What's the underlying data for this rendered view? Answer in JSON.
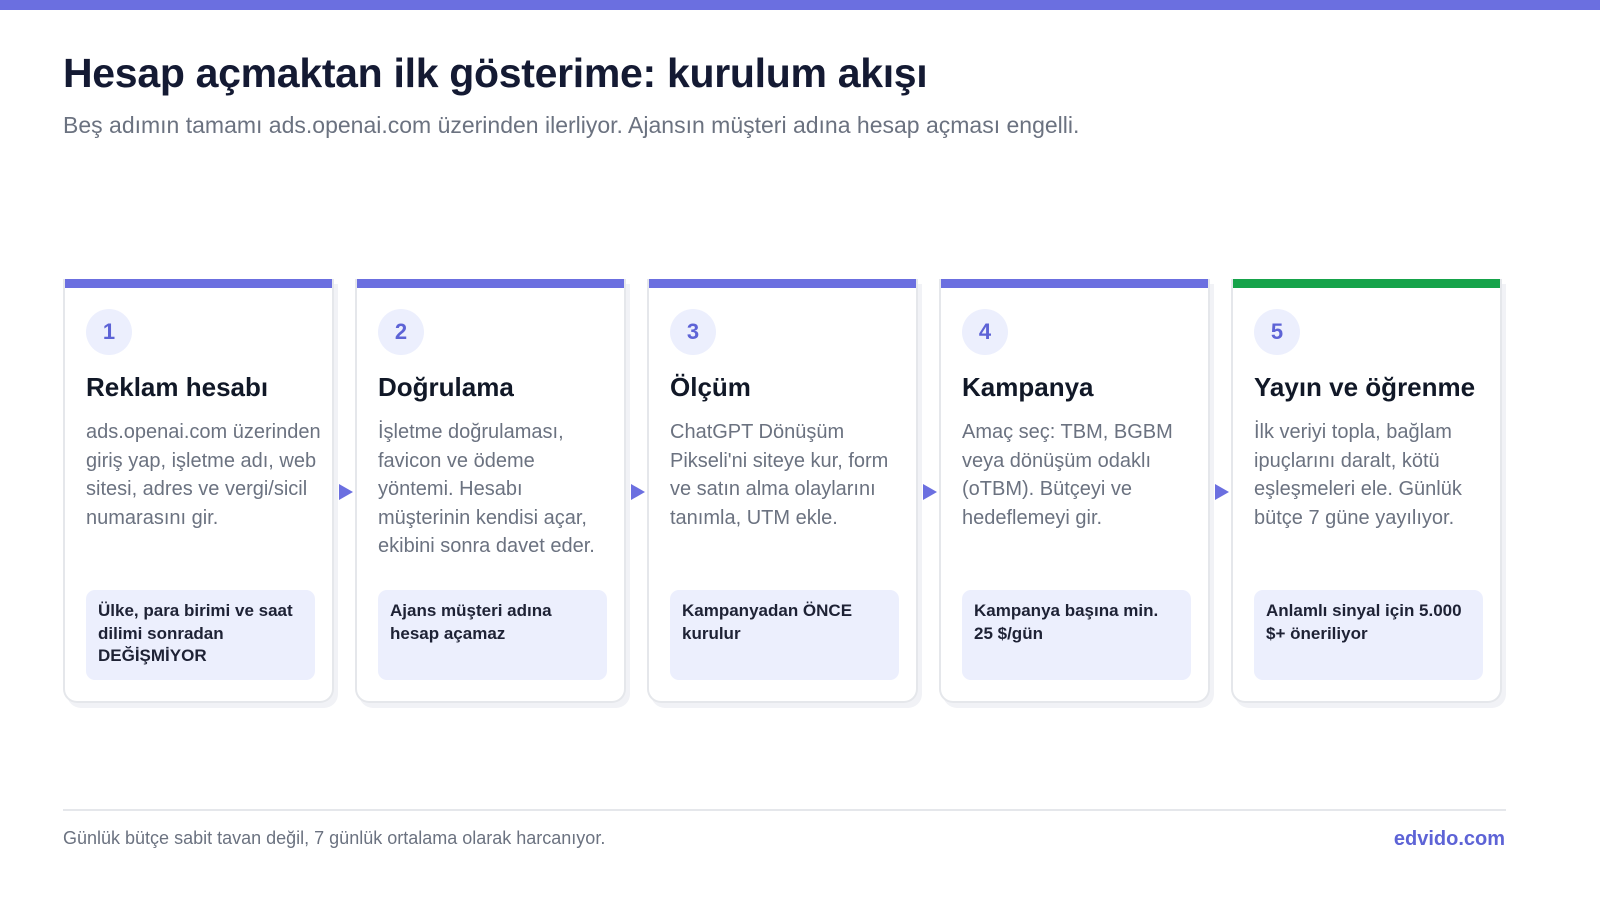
{
  "header": {
    "title": "Hesap açmaktan ilk gösterime: kurulum akışı",
    "subtitle": "Beş adımın tamamı ads.openai.com üzerinden ilerliyor. Ajansın müşteri adına hesap açması engelli."
  },
  "colors": {
    "accent": "#6b6fe0",
    "final_accent": "#16a34a",
    "badge_bg": "#eceffd",
    "note_bg": "#eceffd"
  },
  "steps": [
    {
      "number": "1",
      "title": "Reklam hesabı",
      "description": "ads.openai.com üzerinden giriş yap, işletme adı, web sitesi, adres ve vergi/sicil numarasını gir.",
      "note": "Ülke, para birimi ve saat dilimi sonradan DEĞİŞMİYOR"
    },
    {
      "number": "2",
      "title": "Doğrulama",
      "description": "İşletme doğrulaması, favicon ve ödeme yöntemi. Hesabı müşterinin kendisi açar, ekibini sonra davet eder.",
      "note": "Ajans müşteri adına hesap açamaz"
    },
    {
      "number": "3",
      "title": "Ölçüm",
      "description": "ChatGPT Dönüşüm Pikseli'ni siteye kur, form ve satın alma olaylarını tanımla, UTM ekle.",
      "note": "Kampanyadan ÖNCE kurulur"
    },
    {
      "number": "4",
      "title": "Kampanya",
      "description": "Amaç seç: TBM, BGBM veya dönüşüm odaklı (oTBM). Bütçeyi ve hedeflemeyi gir.",
      "note": "Kampanya başına min. 25 $/gün"
    },
    {
      "number": "5",
      "title": "Yayın ve öğrenme",
      "description": "İlk veriyi topla, bağlam ipuçlarını daralt, kötü eşleşmeleri ele. Günlük bütçe 7 güne yayılıyor.",
      "note": "Anlamlı sinyal için 5.000 $+ öneriliyor"
    }
  ],
  "footer": {
    "note": "Günlük bütçe sabit tavan değil, 7 günlük ortalama olarak harcanıyor.",
    "brand": "edvido.com"
  }
}
